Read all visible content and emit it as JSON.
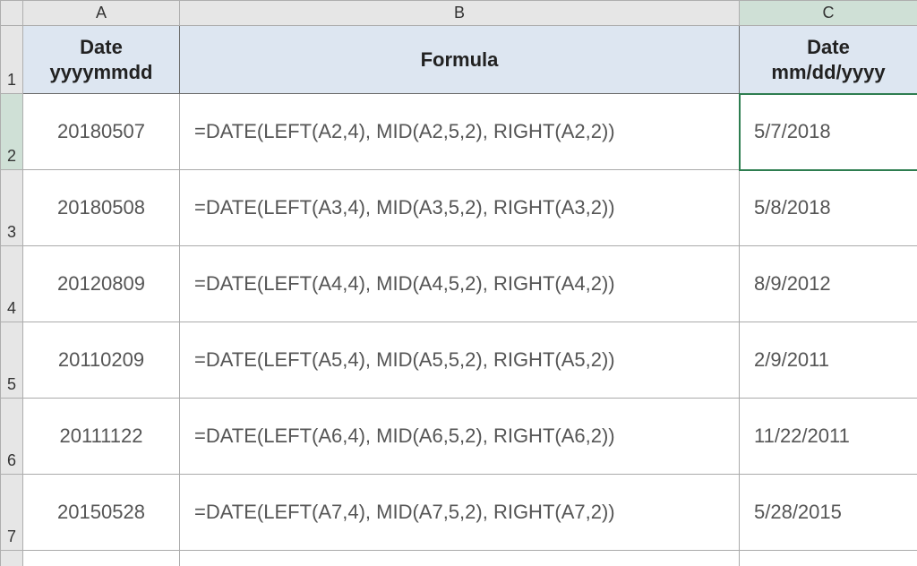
{
  "columns": {
    "A": "A",
    "B": "B",
    "C": "C"
  },
  "rownums": [
    "1",
    "2",
    "3",
    "4",
    "5",
    "6",
    "7"
  ],
  "header": {
    "a": "Date yyyymmdd",
    "b": "Formula",
    "c": "Date mm/dd/yyyy"
  },
  "rows": [
    {
      "a": "20180507",
      "b": "=DATE(LEFT(A2,4), MID(A2,5,2), RIGHT(A2,2))",
      "c": "5/7/2018"
    },
    {
      "a": "20180508",
      "b": "=DATE(LEFT(A3,4), MID(A3,5,2), RIGHT(A3,2))",
      "c": "5/8/2018"
    },
    {
      "a": "20120809",
      "b": "=DATE(LEFT(A4,4), MID(A4,5,2), RIGHT(A4,2))",
      "c": "8/9/2012"
    },
    {
      "a": "20110209",
      "b": "=DATE(LEFT(A5,4), MID(A5,5,2), RIGHT(A5,2))",
      "c": "2/9/2011"
    },
    {
      "a": "20111122",
      "b": "=DATE(LEFT(A6,4), MID(A6,5,2), RIGHT(A6,2))",
      "c": "11/22/2011"
    },
    {
      "a": "20150528",
      "b": "=DATE(LEFT(A7,4), MID(A7,5,2), RIGHT(A7,2))",
      "c": "5/28/2015"
    }
  ],
  "chart_data": {
    "type": "table",
    "columns": [
      "Date yyyymmdd",
      "Formula",
      "Date mm/dd/yyyy"
    ],
    "rows": [
      [
        "20180507",
        "=DATE(LEFT(A2,4), MID(A2,5,2), RIGHT(A2,2))",
        "5/7/2018"
      ],
      [
        "20180508",
        "=DATE(LEFT(A3,4), MID(A3,5,2), RIGHT(A3,2))",
        "5/8/2018"
      ],
      [
        "20120809",
        "=DATE(LEFT(A4,4), MID(A4,5,2), RIGHT(A4,2))",
        "8/9/2012"
      ],
      [
        "20110209",
        "=DATE(LEFT(A5,4), MID(A5,5,2), RIGHT(A5,2))",
        "2/9/2011"
      ],
      [
        "20111122",
        "=DATE(LEFT(A6,4), MID(A6,5,2), RIGHT(A6,2))",
        "11/22/2011"
      ],
      [
        "20150528",
        "=DATE(LEFT(A7,4), MID(A7,5,2), RIGHT(A7,2))",
        "5/28/2015"
      ]
    ]
  }
}
